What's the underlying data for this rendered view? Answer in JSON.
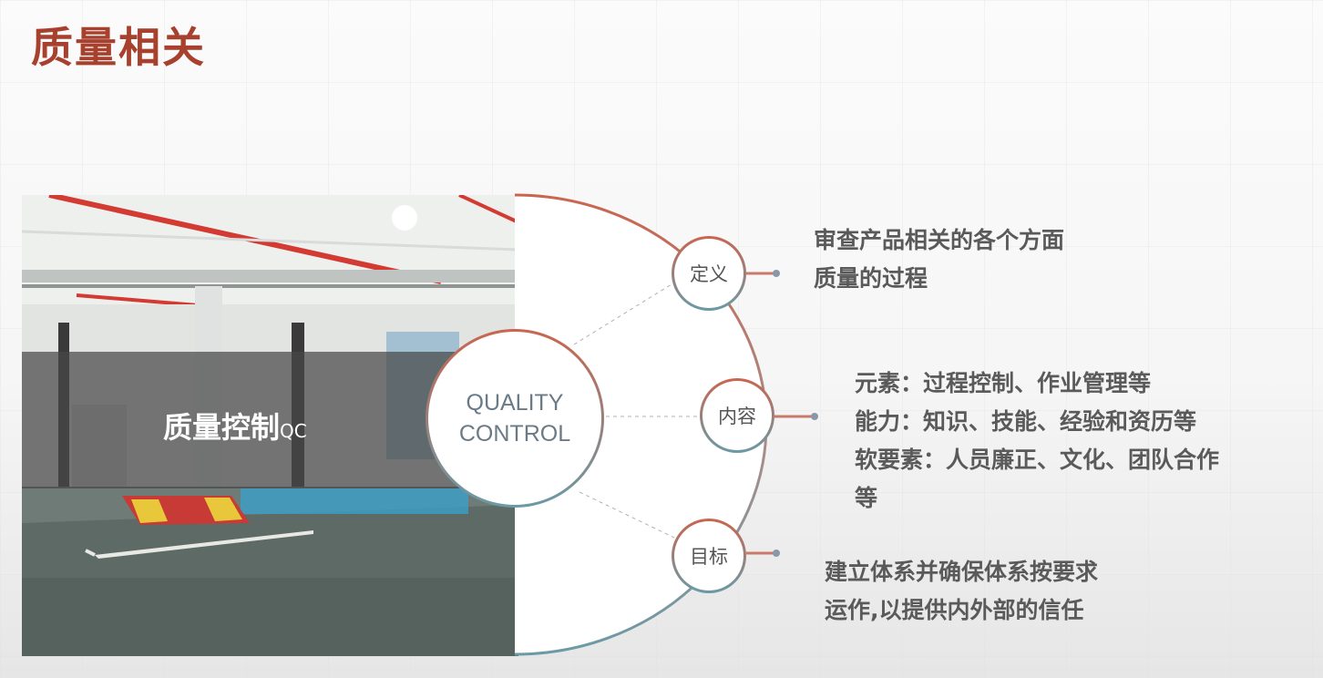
{
  "title": "质量相关",
  "photo": {
    "label_main": "质量控制",
    "label_suffix": "QC"
  },
  "center": {
    "line1": "QUALITY",
    "line2": "CONTROL"
  },
  "nodes": [
    {
      "label": "定义"
    },
    {
      "label": "内容"
    },
    {
      "label": "目标"
    }
  ],
  "descriptions": {
    "definition": [
      "审查产品相关的各个方面",
      "质量的过程"
    ],
    "content": [
      "元素：过程控制、作业管理等",
      "能力：知识、技能、经验和资历等",
      "软要素：人员廉正、文化、团队合作",
      "等"
    ],
    "goal": [
      "建立体系并确保体系按要求",
      "运作,以提供内外部的信任"
    ]
  },
  "colors": {
    "title": "#a8402e",
    "arc_top": "#c9654f",
    "arc_bottom": "#6a9aa6",
    "text": "#5a5a5a"
  }
}
